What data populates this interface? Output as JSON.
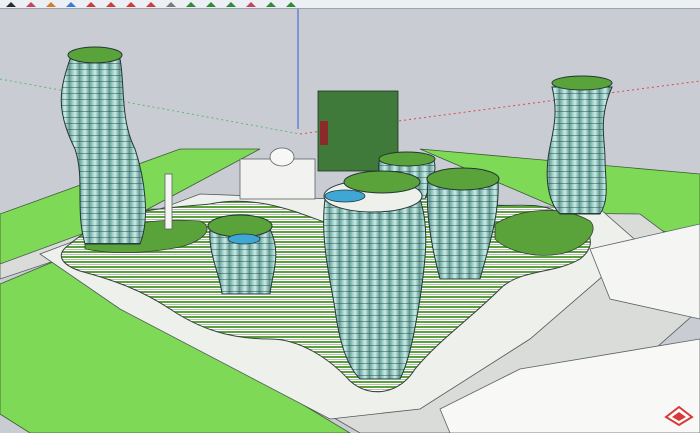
{
  "window": {
    "title": ""
  },
  "toolbar": {
    "tools": [
      {
        "icon": "select-arrow-icon",
        "color": "#2a2a2a"
      },
      {
        "icon": "eraser-icon",
        "color": "#c8445a"
      },
      {
        "icon": "paint-bucket-icon",
        "color": "#d67c2a"
      },
      {
        "icon": "push-pull-icon",
        "color": "#3a7bd5"
      },
      {
        "icon": "move-icon",
        "color": "#d23a3a"
      },
      {
        "icon": "rotate-icon",
        "color": "#d23a3a"
      },
      {
        "icon": "scale-icon",
        "color": "#d23a3a"
      },
      {
        "icon": "offset-icon",
        "color": "#d23a3a"
      },
      {
        "icon": "tape-measure-icon",
        "color": "#7a7a7a"
      },
      {
        "icon": "orbit-icon",
        "color": "#2e8b3a"
      },
      {
        "icon": "pan-icon",
        "color": "#2e8b3a"
      },
      {
        "icon": "zoom-icon",
        "color": "#2e8b3a"
      },
      {
        "icon": "zoom-extents-icon",
        "color": "#c8445a"
      },
      {
        "icon": "previous-view-icon",
        "color": "#2e8b3a"
      },
      {
        "icon": "next-view-icon",
        "color": "#2e8b3a"
      }
    ]
  },
  "scene": {
    "sky_color": "#c9cdd3",
    "grass_color": "#7ed957",
    "plaza_color": "#e9ebe6",
    "tower_glass_color": "#9fd9cf",
    "roof_garden_color": "#5aa23a",
    "axis_colors": {
      "blue": "#3a5bd6",
      "red": "#d84a4a",
      "green": "#5ab96a"
    }
  },
  "logo": {
    "icon": "app-logo-icon",
    "color": "#d83a3a"
  }
}
